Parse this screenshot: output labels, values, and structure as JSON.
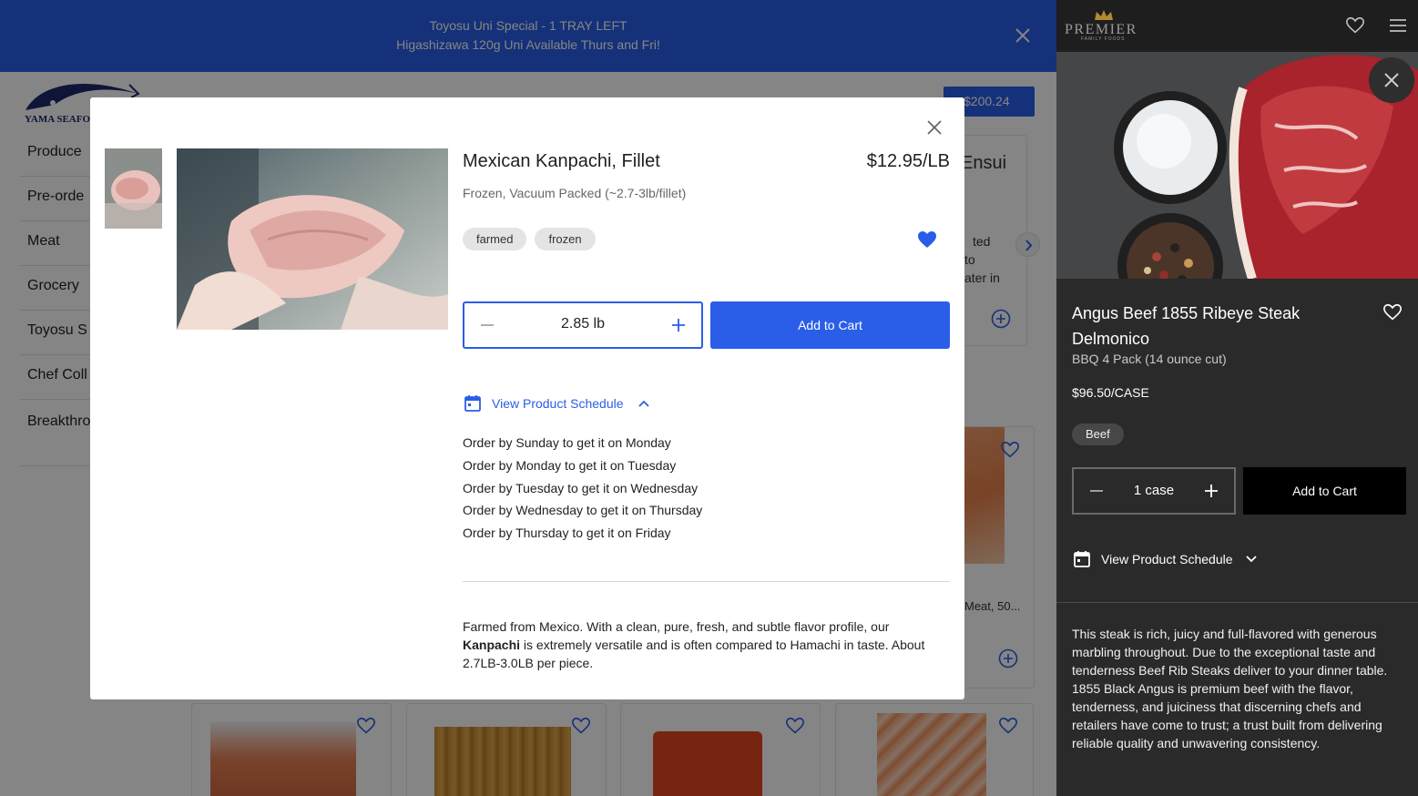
{
  "banner": {
    "line1": "Toyosu Uni Special - 1 TRAY LEFT",
    "line2": "Higashizawa 120g Uni Available Thurs and Fri!"
  },
  "store": {
    "logo_text": "YAMA SEAFO",
    "cart_total": "$200.24",
    "categories": [
      "Produce",
      "Pre-orde",
      "Meat",
      "Grocery",
      "Toyosu S",
      "Chef Coll",
      "Breakthro Sushi Cla"
    ],
    "card_fragments": {
      "title_partial": "Ensui",
      "text_line1": "ted",
      "text_line2": "to",
      "text_line3": "ater in",
      "meat_line": "Meat, 50..."
    }
  },
  "modal": {
    "title": "Mexican Kanpachi, Fillet",
    "price": "$12.95/LB",
    "subtitle": "Frozen, Vacuum Packed (~2.7-3lb/fillet)",
    "tags": [
      "farmed",
      "frozen"
    ],
    "quantity": "2.85 lb",
    "add_to_cart": "Add to Cart",
    "schedule_label": "View Product Schedule",
    "schedule": [
      "Order by Sunday to get it on Monday",
      "Order by Monday to get it on Tuesday",
      "Order by Tuesday to get it on Wednesday",
      "Order by Wednesday to get it on Thursday",
      "Order by Thursday to get it on Friday"
    ],
    "description": {
      "part1": "Farmed from Mexico. With a clean, pure, fresh, and subtle flavor profile, our ",
      "bold": "Kanpachi",
      "part2": " is extremely versatile and is often compared to Hamachi in taste. About 2.7LB-3.0LB per piece."
    }
  },
  "panel": {
    "logo_name": "PREMIER",
    "logo_sub": "FAMILY FOODS",
    "title": "Angus Beef 1855 Ribeye Steak Delmonico",
    "subtitle": "BBQ 4 Pack (14 ounce cut)",
    "price": "$96.50/CASE",
    "tag": "Beef",
    "quantity": "1 case",
    "add_to_cart": "Add to Cart",
    "schedule_label": "View Product Schedule",
    "description": "This steak is rich, juicy and full-flavored with generous marbling throughout. Due to the exceptional taste and tenderness Beef Rib Steaks deliver to your dinner table.  1855 Black Angus is premium beef with the flavor, tenderness, and juiciness that discerning chefs and retailers have come to trust; a trust built from delivering reliable quality and unwavering consistency."
  },
  "colors": {
    "accent": "#2a5ee8",
    "panel_bg": "#2a2a2a",
    "overlay": "rgba(0,0,0,0.48)"
  },
  "icons": [
    "close-icon",
    "heart-icon",
    "plus-icon",
    "minus-icon",
    "calendar-icon",
    "chevron-up-icon",
    "chevron-down-icon",
    "chevron-right-icon",
    "menu-icon",
    "plus-circle-icon"
  ]
}
